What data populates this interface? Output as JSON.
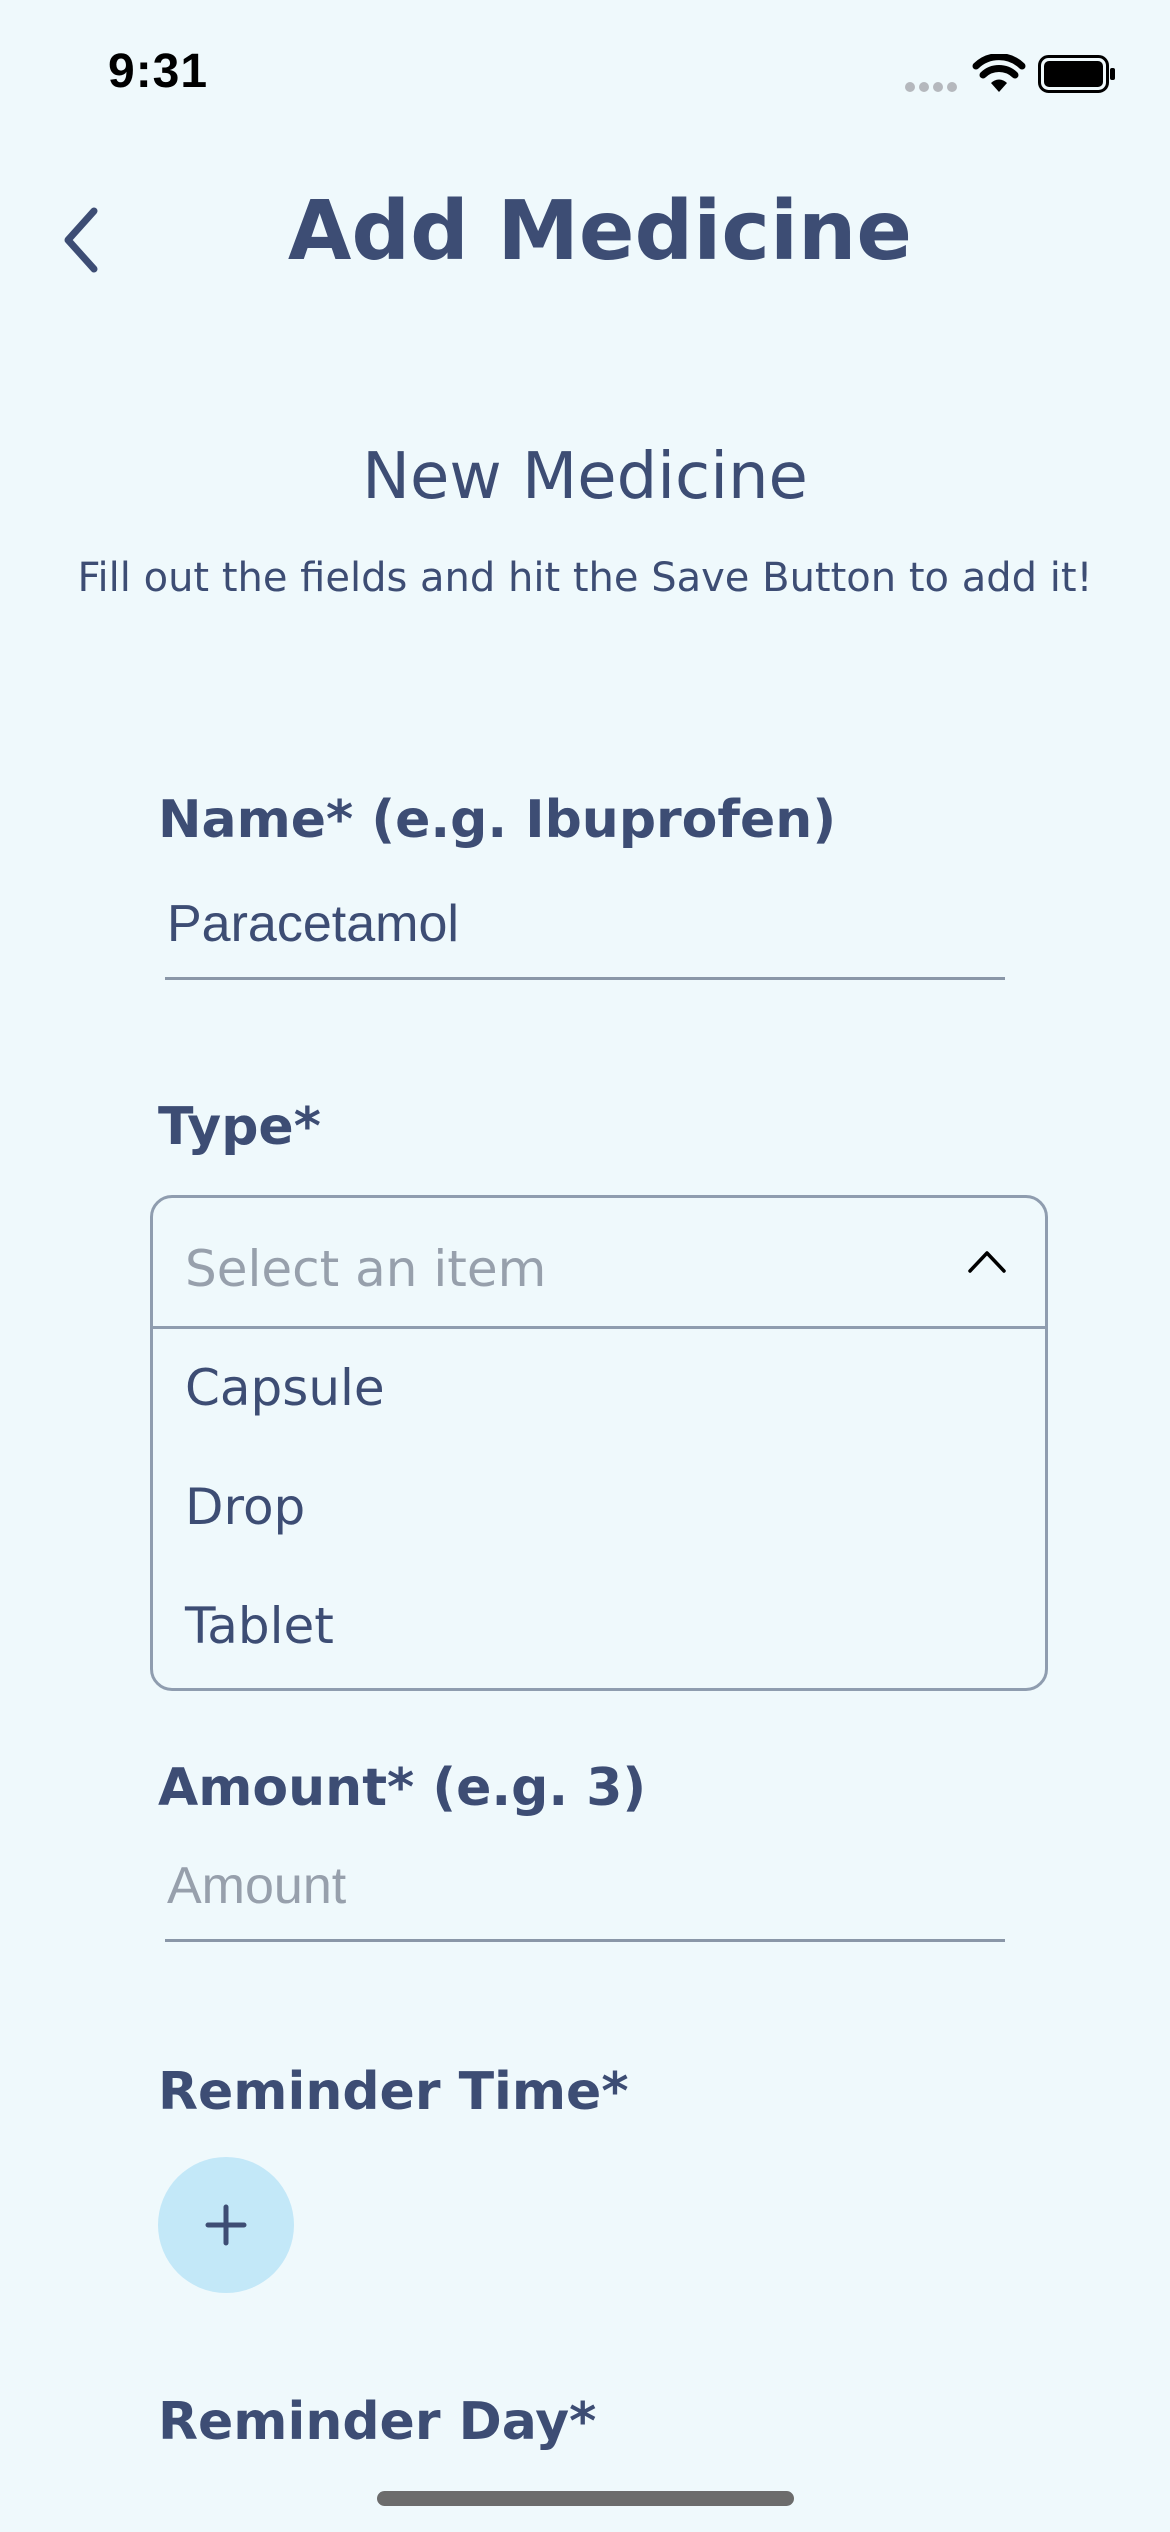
{
  "status_bar": {
    "time": "9:31"
  },
  "header": {
    "title": "Add Medicine",
    "back_icon": "chevron-left-icon"
  },
  "intro": {
    "title": "New Medicine",
    "subtitle": "Fill out the fields and hit the Save Button to add it!"
  },
  "form": {
    "name": {
      "label": "Name* (e.g. Ibuprofen)",
      "value": "Paracetamol"
    },
    "type": {
      "label": "Type*",
      "placeholder": "Select an item",
      "options": [
        "Capsule",
        "Drop",
        "Tablet"
      ]
    },
    "amount": {
      "label": "Amount* (e.g. 3)",
      "value": "",
      "placeholder": "Amount"
    },
    "reminder_time": {
      "label": "Reminder Time*",
      "add_icon": "plus-icon"
    },
    "reminder_day": {
      "label": "Reminder Day*"
    }
  },
  "colors": {
    "background": "#eff9fc",
    "primary_text": "#3d4d74",
    "placeholder_text": "#97a0ac",
    "add_button_bg": "#c3e8f8",
    "border": "#8f9daf"
  }
}
